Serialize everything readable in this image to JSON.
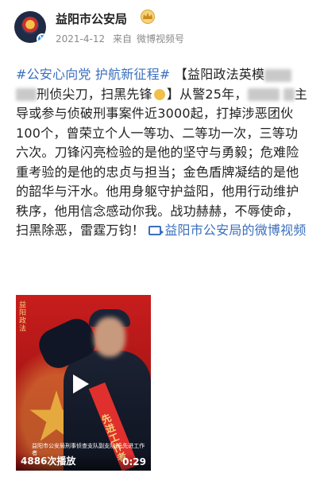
{
  "account": {
    "name": "益阳市公安局",
    "date": "2021-4-12",
    "source_prefix": "来自",
    "source": "微博视频号",
    "avatar_icon": "police-emblem-icon",
    "verified_icon": "verified-v-icon",
    "crown_icon": "crown-icon"
  },
  "post": {
    "hashtag": "#公安心向党 护航新征程#",
    "bracket_open": "【益阳政法英模",
    "title_mid": "刑侦尖刀，扫黑先锋",
    "bracket_close": "】",
    "after_title": "从警25年，",
    "line_lead": "主导或参与侦破刑事案件近3000起，打掉涉恶团伙100个，曾荣立个人一等功、二等功一次，三等功六次。刀锋闪亮检验的是他的坚守与勇毅；危难险重考验的是他的忠贞与担当；金色盾牌凝结的是他的韶华与汗水。他用身躯守护益阳，他用行动维护秩序，他用信念感动你我。战功赫赫，不辱使命，扫黑除恶，雷霆万钧！",
    "video_link": "益阳市公安局的微博视频",
    "link_icon": "video-link-icon"
  },
  "video": {
    "side_text": "益阳政法",
    "caption": "益阳市公安局刑事侦查支队副支队长 先进工作者",
    "sash_text": "先进工作者",
    "play_count": "4886次播放",
    "duration": "0:29",
    "play_icon": "play-icon"
  },
  "colors": {
    "link": "#3b6fbf",
    "video_red": "#c81d1d",
    "gold": "#e9b340"
  }
}
